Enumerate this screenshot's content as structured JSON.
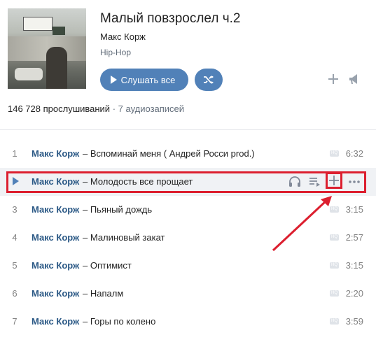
{
  "album": {
    "title": "Малый повзрослел ч.2",
    "artist": "Макс Корж",
    "genre": "Hip-Hop",
    "listen_all_label": "Слушать все",
    "plays": "146 728 прослушиваний",
    "separator": " · ",
    "tracks_count": "7 аудиозаписей"
  },
  "tracks": [
    {
      "num": "1",
      "artist": "Макс Корж",
      "title": "– Вспоминай меня ( Андрей Росси prod.)",
      "duration": "6:32",
      "hq": "HQ"
    },
    {
      "num": "",
      "artist": "Макс Корж",
      "title": "– Молодость все прощает",
      "duration": "",
      "hq": ""
    },
    {
      "num": "3",
      "artist": "Макс Корж",
      "title": "– Пьяный дождь",
      "duration": "3:15",
      "hq": "HQ"
    },
    {
      "num": "4",
      "artist": "Макс Корж",
      "title": "– Малиновый закат",
      "duration": "2:57",
      "hq": "HQ"
    },
    {
      "num": "5",
      "artist": "Макс Корж",
      "title": "– Оптимист",
      "duration": "3:15",
      "hq": "HQ"
    },
    {
      "num": "6",
      "artist": "Макс Корж",
      "title": "– Напалм",
      "duration": "2:20",
      "hq": "HQ"
    },
    {
      "num": "7",
      "artist": "Макс Корж",
      "title": "– Горы по колено",
      "duration": "3:59",
      "hq": "HQ"
    }
  ],
  "colors": {
    "accent": "#5181b8",
    "link": "#2a5885",
    "highlight": "#dc1f2f"
  },
  "icons": [
    "play-icon",
    "shuffle-icon",
    "plus-icon",
    "share-icon",
    "headphones-icon",
    "add-to-queue-icon",
    "more-icon",
    "hq-badge-icon"
  ]
}
